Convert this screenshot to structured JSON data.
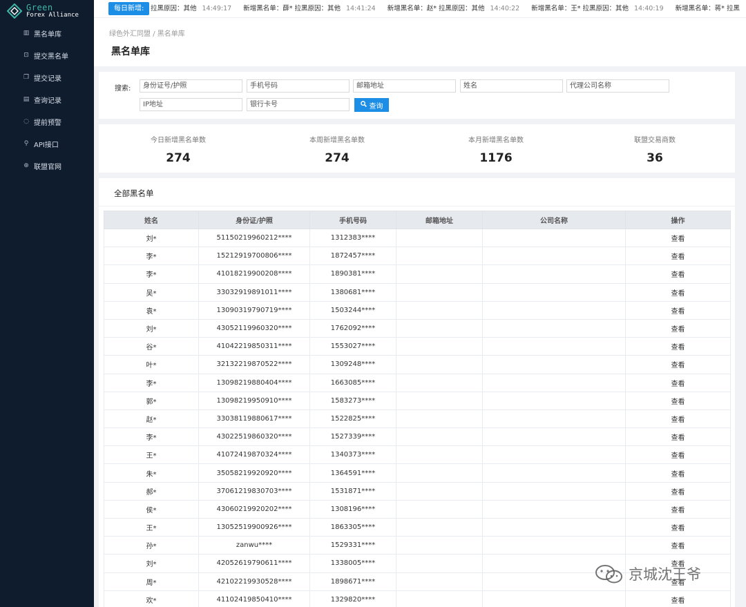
{
  "app": {
    "logo_line1": "Green",
    "logo_line2": "Forex Alliance"
  },
  "sidebar": {
    "items": [
      {
        "label": "黑名单库",
        "icon": "database-icon"
      },
      {
        "label": "提交黑名单",
        "icon": "submit-icon"
      },
      {
        "label": "提交记录",
        "icon": "copy-icon"
      },
      {
        "label": "查询记录",
        "icon": "list-icon"
      },
      {
        "label": "提前预警",
        "icon": "bell-icon"
      },
      {
        "label": "API接口",
        "icon": "link-icon"
      },
      {
        "label": "联盟官网",
        "icon": "globe-icon"
      }
    ]
  },
  "ticker": {
    "badge": "每日新增:",
    "items": [
      {
        "text": "拉黑原因：其他",
        "time": "14:49:17"
      },
      {
        "text": "新增黑名单：薛*  拉黑原因：其他",
        "time": "14:41:24"
      },
      {
        "text": "新增黑名单：赵*  拉黑原因：其他",
        "time": "14:40:22"
      },
      {
        "text": "新增黑名单：王*  拉黑原因：其他",
        "time": "14:40:19"
      },
      {
        "text": "新增黑名单：蒋*  拉黑",
        "time": ""
      }
    ]
  },
  "breadcrumb": {
    "root": "绿色外汇同盟",
    "sep": "/",
    "current": "黑名单库"
  },
  "page_title": "黑名单库",
  "search": {
    "label": "搜索:",
    "fields": {
      "id": "身份证号/护照",
      "phone": "手机号码",
      "email": "邮箱地址",
      "name": "姓名",
      "agent": "代理公司名称",
      "ip": "IP地址",
      "bank": "银行卡号"
    },
    "button": "查询"
  },
  "stats": [
    {
      "label": "今日新增黑名单数",
      "value": "274"
    },
    {
      "label": "本周新增黑名单数",
      "value": "274"
    },
    {
      "label": "本月新增黑名单数",
      "value": "1176"
    },
    {
      "label": "联盟交易商数",
      "value": "36"
    }
  ],
  "table": {
    "title": "全部黑名单",
    "columns": [
      "姓名",
      "身份证/护照",
      "手机号码",
      "邮箱地址",
      "公司名称",
      "操作"
    ],
    "action_label": "查看",
    "rows": [
      [
        "刘*",
        "51150219960212****",
        "1312383****",
        "",
        ""
      ],
      [
        "李*",
        "15212919700806****",
        "1872457****",
        "",
        ""
      ],
      [
        "李*",
        "41018219900208****",
        "1890381****",
        "",
        ""
      ],
      [
        "吴*",
        "33032919891011****",
        "1380681****",
        "",
        ""
      ],
      [
        "袁*",
        "13090319790719****",
        "1503244****",
        "",
        ""
      ],
      [
        "刘*",
        "43052119960320****",
        "1762092****",
        "",
        ""
      ],
      [
        "谷*",
        "41042219850311****",
        "1553027****",
        "",
        ""
      ],
      [
        "叶*",
        "32132219870522****",
        "1309248****",
        "",
        ""
      ],
      [
        "李*",
        "13098219880404****",
        "1663085****",
        "",
        ""
      ],
      [
        "郭*",
        "13098219950910****",
        "1583273****",
        "",
        ""
      ],
      [
        "赵*",
        "33038119880617****",
        "1522825****",
        "",
        ""
      ],
      [
        "李*",
        "43022519860320****",
        "1527339****",
        "",
        ""
      ],
      [
        "王*",
        "41072419870324****",
        "1340373****",
        "",
        ""
      ],
      [
        "朱*",
        "35058219920920****",
        "1364591****",
        "",
        ""
      ],
      [
        "郝*",
        "37061219830703****",
        "1531871****",
        "",
        ""
      ],
      [
        "侯*",
        "43060219920202****",
        "1308196****",
        "",
        ""
      ],
      [
        "王*",
        "13052519900926****",
        "1863305****",
        "",
        ""
      ],
      [
        "孙*",
        "zanwu****",
        "1529331****",
        "",
        ""
      ],
      [
        "刘*",
        "42052619790611****",
        "1338005****",
        "",
        ""
      ],
      [
        "周*",
        "42102219930528****",
        "1898671****",
        "",
        ""
      ],
      [
        "欢*",
        "41102419850410****",
        "1329820****",
        "",
        ""
      ]
    ]
  },
  "watermark": "京城沈王爷"
}
